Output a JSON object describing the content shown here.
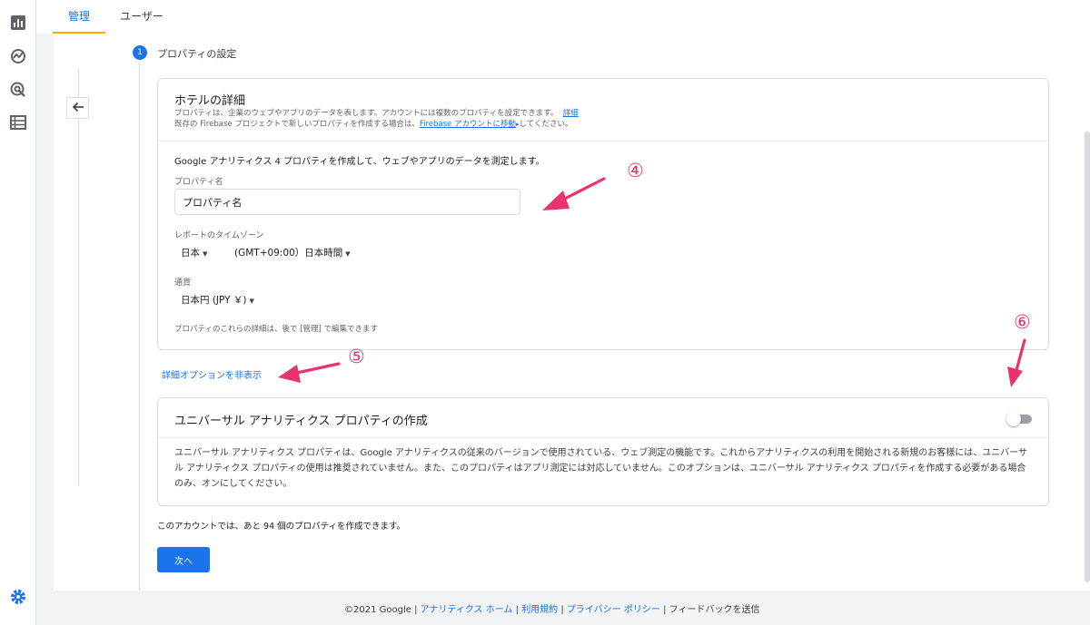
{
  "tabs": [
    {
      "label": "管理"
    },
    {
      "label": "ユーザー"
    }
  ],
  "step": {
    "number": "1",
    "title": "プロパティの設定"
  },
  "details_card": {
    "title": "ホテルの詳細",
    "desc_line1": "プロパティは、企業のウェブやアプリのデータを表します。アカウントには複数のプロパティを設定できます。",
    "desc_line1_link": "詳細",
    "desc_line2_prefix": "既存の Firebase プロジェクトで新しいプロパティを作成する場合は、",
    "desc_line2_link": "Firebase アカウントに移動",
    "desc_line2_suffix": "してください。",
    "intro": "Google アナリティクス 4 プロパティを作成して、ウェブやアプリのデータを測定します。",
    "property_name_label": "プロパティ名",
    "property_name_value": "プロパティ名",
    "timezone_label": "レポートのタイムゾーン",
    "timezone_country": "日本",
    "timezone_value": "(GMT+09:00）日本時間",
    "currency_label": "通貨",
    "currency_value": "日本円 (JPY ￥)",
    "edit_note": "プロパティのこれらの詳細は、後で [管理] で編集できます"
  },
  "advanced_options_link": "詳細オプションを非表示",
  "ua_card": {
    "title": "ユニバーサル アナリティクス プロパティの作成",
    "toggle_on": false,
    "description": "ユニバーサル アナリティクス プロパティは、Google アナリティクスの従来のバージョンで使用されている、ウェブ測定の機能です。これからアナリティクスの利用を開始される新規のお客様には、ユニバーサル アナリティクス プロパティの使用は推奨されていません。また、このプロパティはアプリ測定には対応していません。このオプションは、ユニバーサル アナリティクス プロパティを作成する必要がある場合のみ、オンにしてください。"
  },
  "remaining_text": "このアカウントでは、あと 94 個のプロパティを作成できます。",
  "next_button": "次へ",
  "footer": {
    "copyright": "©2021 Google",
    "sep": "|",
    "home": "アナリティクス ホーム",
    "terms": "利用規約",
    "privacy": "プライバシー ポリシー",
    "feedback": "フィードバックを送信"
  },
  "annotations": {
    "n4": "④",
    "n5": "⑤",
    "n6": "⑥"
  },
  "colors": {
    "accent": "#1a73e8",
    "annotation": "#e8336d",
    "tab_underline": "#f9ab00"
  },
  "rail_icons": [
    "bar-chart-icon",
    "realtime-icon",
    "target-icon",
    "list-icon",
    "gear-icon"
  ]
}
